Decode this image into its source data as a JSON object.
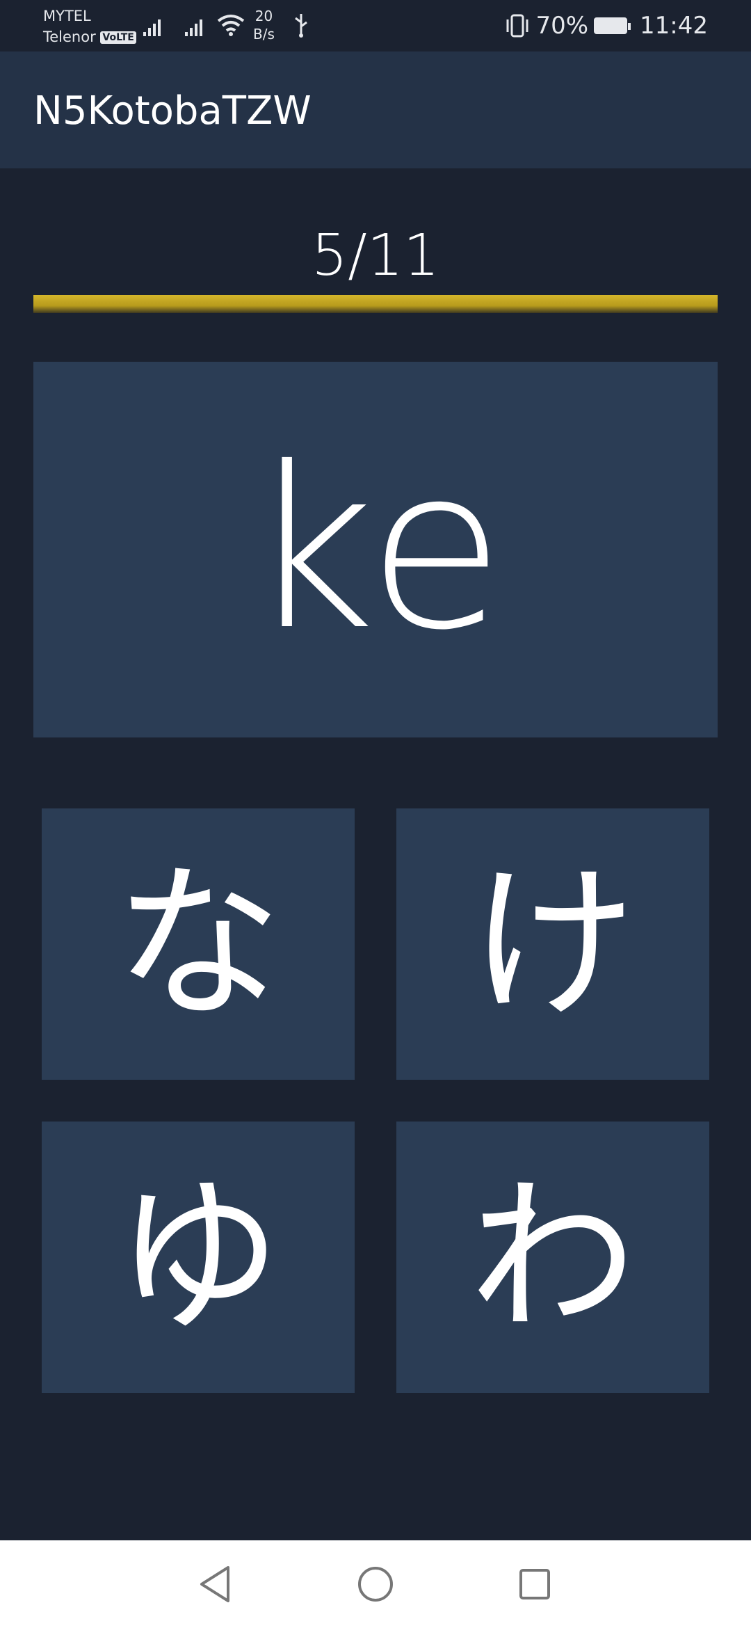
{
  "status_bar": {
    "carrier_1": "MYTEL",
    "carrier_2": "Telenor",
    "volte": "VoLTE",
    "speed_value": "20",
    "speed_unit": "B/s",
    "battery": "70%",
    "time": "11:42"
  },
  "app_bar": {
    "title": "N5KotobaTZW"
  },
  "quiz": {
    "progress_label": "5/11",
    "progress_fraction": 1.0,
    "question": "ke",
    "answers": [
      "な",
      "け",
      "ゆ",
      "わ"
    ]
  },
  "colors": {
    "background": "#1b2230",
    "app_bar": "#243247",
    "card": "#2b3d55",
    "progress": "#c9a923",
    "nav_bar": "#ffffff"
  },
  "icons": {
    "signal": "signal-icon",
    "wifi": "wifi-icon",
    "usb": "usb-icon",
    "vibrate": "vibrate-icon",
    "battery": "battery-charging-icon",
    "back": "back-triangle-icon",
    "home": "home-circle-icon",
    "recent": "recent-square-icon"
  }
}
